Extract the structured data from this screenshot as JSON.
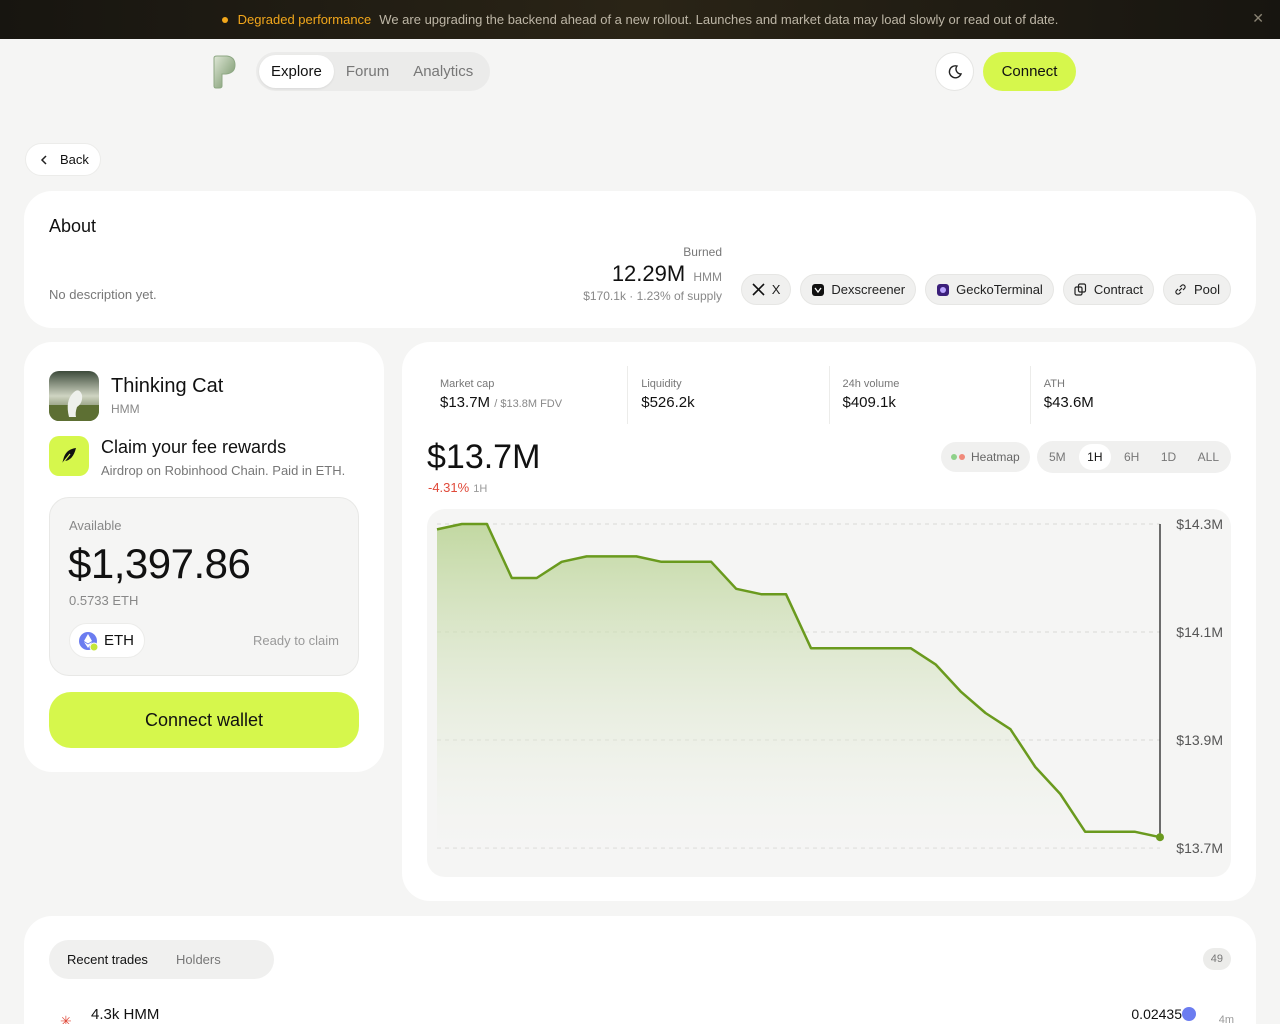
{
  "banner": {
    "title": "Degraded performance",
    "message": "We are upgrading the backend ahead of a new rollout. Launches and market data may load slowly or read out of date.",
    "close": "✕"
  },
  "nav": {
    "tabs": [
      "Explore",
      "Forum",
      "Analytics"
    ],
    "active": "Explore"
  },
  "header": {
    "connect": "Connect"
  },
  "back": {
    "label": "Back"
  },
  "about": {
    "title": "About",
    "description": "No description yet.",
    "burned_label": "Burned",
    "burned_value": "12.29M",
    "burned_unit": "HMM",
    "burned_usd": "$170.1k",
    "burned_pct": "1.23% of supply",
    "links": [
      "X",
      "Dexscreener",
      "GeckoTerminal",
      "Contract",
      "Pool"
    ]
  },
  "token": {
    "name": "Thinking Cat",
    "symbol": "HMM",
    "claim_title": "Claim your fee rewards",
    "claim_subtitle": "Airdrop on Robinhood Chain. Paid in ETH.",
    "available_label": "Available",
    "available_amount": "$1,397.86",
    "available_eth": "0.5733 ETH",
    "asset": "ETH",
    "ready": "Ready to claim",
    "connect_wallet": "Connect wallet"
  },
  "stats": [
    {
      "label": "Market cap",
      "value": "$13.7M",
      "extra": "/ $13.8M FDV"
    },
    {
      "label": "Liquidity",
      "value": "$526.2k",
      "extra": ""
    },
    {
      "label": "24h volume",
      "value": "$409.1k",
      "extra": ""
    },
    {
      "label": "ATH",
      "value": "$43.6M",
      "extra": ""
    }
  ],
  "price": {
    "value": "$13.7M",
    "change": "-4.31%",
    "period": "1H"
  },
  "controls": {
    "heatmap": "Heatmap",
    "ranges": [
      "5M",
      "1H",
      "6H",
      "1D",
      "ALL"
    ],
    "active_range": "1H"
  },
  "chart_data": {
    "type": "area",
    "y_ticks": [
      "$14.3M",
      "$14.1M",
      "$13.9M",
      "$13.7M"
    ],
    "ylim": [
      13.7,
      14.3
    ],
    "x": [
      0,
      1,
      2,
      3,
      4,
      5,
      6,
      7,
      8,
      9,
      10,
      11,
      12,
      13,
      14,
      15,
      16,
      17,
      18,
      19,
      20,
      21,
      22,
      23,
      24,
      25,
      26,
      27,
      28,
      29
    ],
    "values": [
      14.29,
      14.3,
      14.3,
      14.2,
      14.2,
      14.23,
      14.24,
      14.24,
      14.24,
      14.23,
      14.23,
      14.23,
      14.18,
      14.17,
      14.17,
      14.07,
      14.07,
      14.07,
      14.07,
      14.07,
      14.04,
      13.99,
      13.95,
      13.92,
      13.85,
      13.8,
      13.73,
      13.73,
      13.73,
      13.72
    ],
    "colors": {
      "line": "#6a9a1e",
      "fill": "#c7dba8"
    }
  },
  "trades": {
    "tabs": [
      "Recent trades",
      "Holders"
    ],
    "count": "49",
    "rows": [
      {
        "amount": "4.3k HMM",
        "value": "0.02435",
        "time": "4m"
      }
    ]
  }
}
